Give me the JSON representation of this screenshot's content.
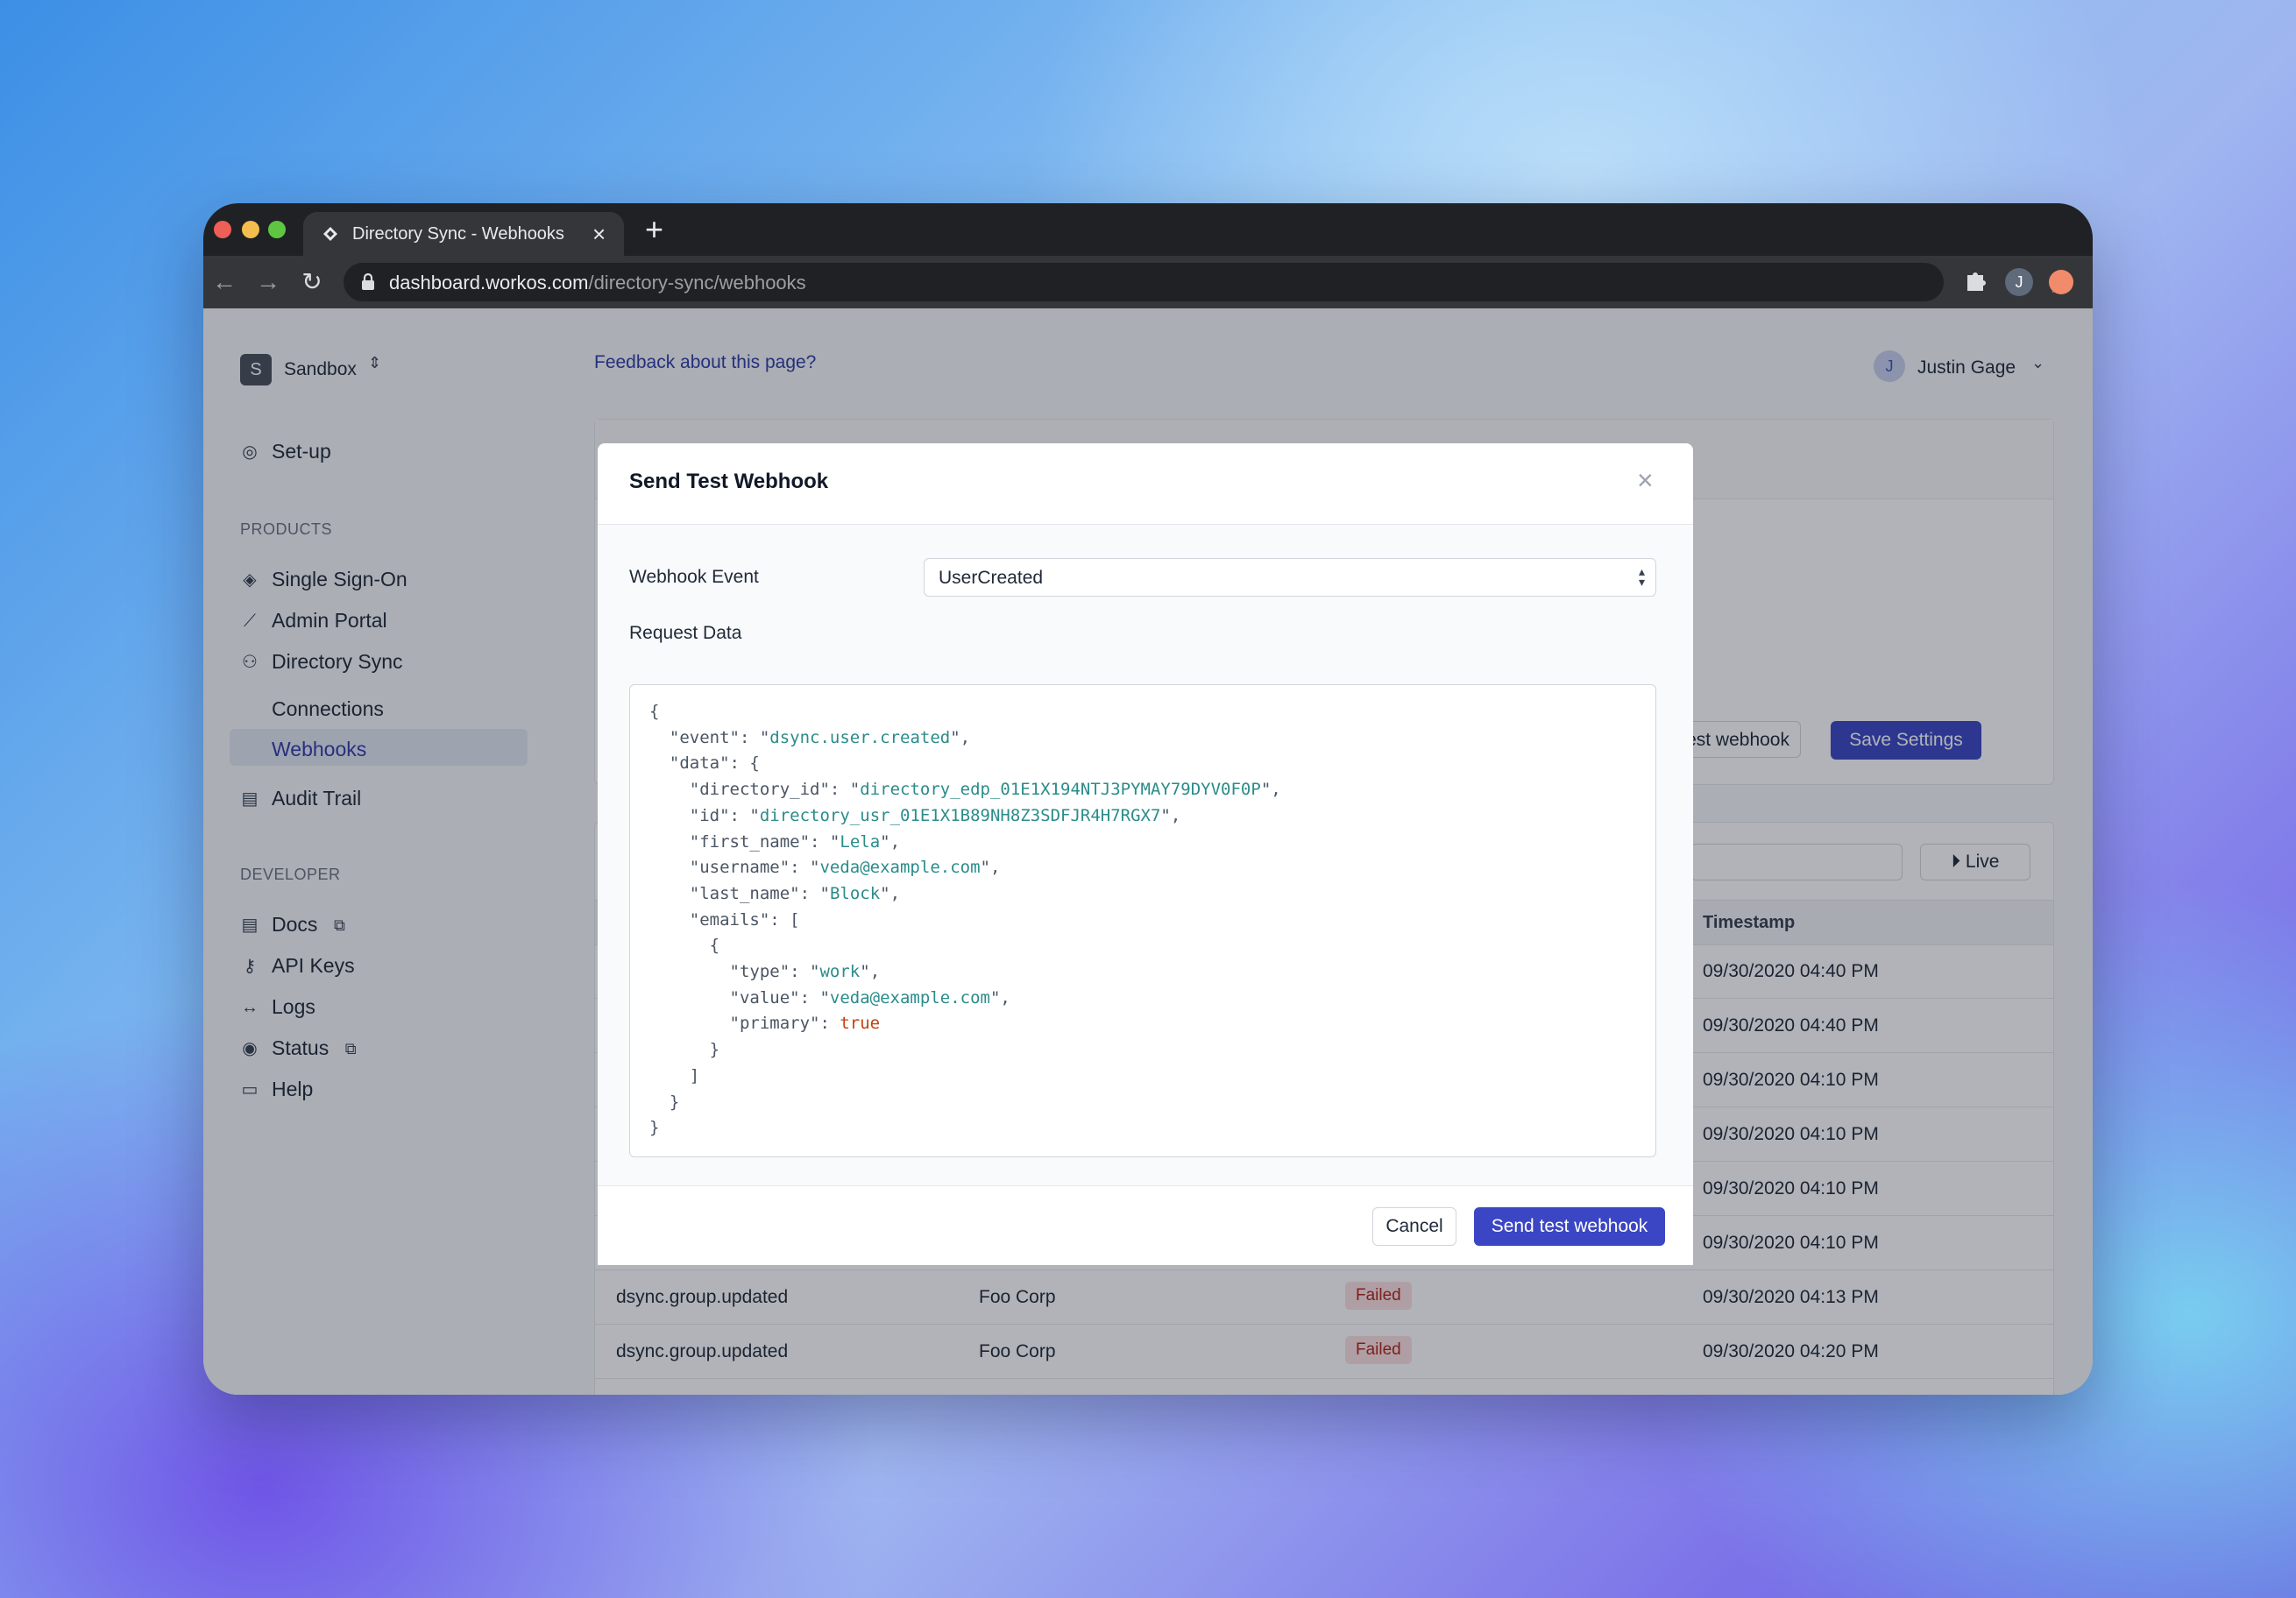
{
  "browser": {
    "tab_title": "Directory Sync - Webhooks",
    "url_host": "dashboard.workos.com",
    "url_path": "/directory-sync/webhooks",
    "profile_initial": "J"
  },
  "workspace": {
    "badge": "S",
    "name": "Sandbox"
  },
  "sidebar": {
    "setup": "Set-up",
    "products_heading": "PRODUCTS",
    "sso": "Single Sign-On",
    "admin_portal": "Admin Portal",
    "directory_sync": "Directory Sync",
    "connections": "Connections",
    "webhooks": "Webhooks",
    "audit_trail": "Audit Trail",
    "developer_heading": "DEVELOPER",
    "docs": "Docs",
    "api_keys": "API Keys",
    "logs": "Logs",
    "status": "Status",
    "help": "Help"
  },
  "header": {
    "feedback_link": "Feedback about this page?",
    "user_initial": "J",
    "user_name": "Justin Gage"
  },
  "settings_card": {
    "send_test_partial": "end test webhook",
    "save_settings": "Save Settings"
  },
  "events_table": {
    "live_button": "Live",
    "timestamp_header": "Timestamp",
    "timestamps": [
      "09/30/2020 04:40 PM",
      "09/30/2020 04:40 PM",
      "09/30/2020 04:10 PM",
      "09/30/2020 04:10 PM",
      "09/30/2020 04:10 PM",
      "09/30/2020 04:10 PM"
    ],
    "visible_rows": [
      {
        "event": "dsync.group.updated",
        "directory": "Foo Corp",
        "status": "Failed",
        "timestamp": "09/30/2020 04:13 PM"
      },
      {
        "event": "dsync.group.updated",
        "directory": "Foo Corp",
        "status": "Failed",
        "timestamp": "09/30/2020 04:20 PM"
      }
    ]
  },
  "modal": {
    "title": "Send Test Webhook",
    "event_label": "Webhook Event",
    "event_value": "UserCreated",
    "request_label": "Request Data",
    "payload": {
      "event": "dsync.user.created",
      "directory_id": "directory_edp_01E1X194NTJ3PYMAY79DYV0F0P",
      "id": "directory_usr_01E1X1B89NH8Z3SDFJR4H7RGX7",
      "first_name": "Lela",
      "username": "veda@example.com",
      "last_name": "Block",
      "email_type": "work",
      "email_value": "veda@example.com",
      "email_primary": "true"
    },
    "cancel": "Cancel",
    "send": "Send test webhook"
  }
}
